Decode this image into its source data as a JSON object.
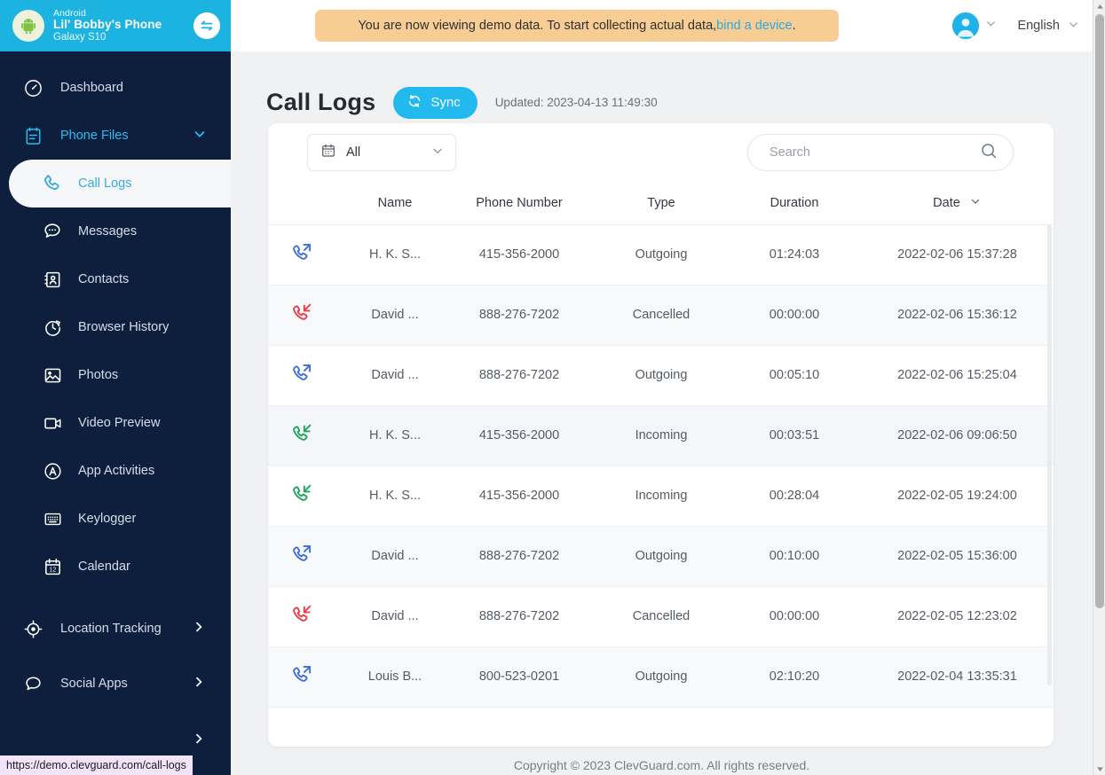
{
  "device": {
    "os": "Android",
    "name": "Lil' Bobby's Phone",
    "model": "Galaxy S10",
    "avatar_icon": "android-robot-icon",
    "switch_icon": "switch-device-icon"
  },
  "header": {
    "banner_text_before": "You are now viewing demo data. To start collecting actual data, ",
    "banner_link": "bind a device",
    "banner_text_after": ".",
    "banner_color": "#f8cd94",
    "user_icon": "user-avatar-icon",
    "user_chevron_icon": "chevron-down-icon",
    "language": "English",
    "language_chevron_icon": "chevron-down-icon"
  },
  "sidebar": {
    "accent_color": "#27bdf0",
    "background_color": "#0d1f3c",
    "items": [
      {
        "label": "Dashboard",
        "icon": "dashboard-gauge-icon",
        "level": "top",
        "active": false,
        "chevron": ""
      },
      {
        "label": "Phone Files",
        "icon": "clipboard-icon",
        "level": "group",
        "active": false,
        "chevron": "down"
      },
      {
        "label": "Call Logs",
        "icon": "phone-handset-icon",
        "level": "sub",
        "active": true,
        "chevron": ""
      },
      {
        "label": "Messages",
        "icon": "chat-bubble-dots-icon",
        "level": "sub",
        "active": false,
        "chevron": ""
      },
      {
        "label": "Contacts",
        "icon": "contact-card-icon",
        "level": "sub",
        "active": false,
        "chevron": ""
      },
      {
        "label": "Browser History",
        "icon": "clock-history-icon",
        "level": "sub",
        "active": false,
        "chevron": ""
      },
      {
        "label": "Photos",
        "icon": "image-photo-icon",
        "level": "sub",
        "active": false,
        "chevron": ""
      },
      {
        "label": "Video Preview",
        "icon": "video-camera-icon",
        "level": "sub",
        "active": false,
        "chevron": ""
      },
      {
        "label": "App Activities",
        "icon": "app-circle-a-icon",
        "level": "sub",
        "active": false,
        "chevron": ""
      },
      {
        "label": "Keylogger",
        "icon": "keyboard-icon",
        "level": "sub",
        "active": false,
        "chevron": ""
      },
      {
        "label": "Calendar",
        "icon": "calendar-icon",
        "level": "sub",
        "active": false,
        "chevron": ""
      },
      {
        "label": "Location Tracking",
        "icon": "location-target-icon",
        "level": "top",
        "active": false,
        "chevron": "right"
      },
      {
        "label": "Social Apps",
        "icon": "chat-bubble-icon",
        "level": "top",
        "active": false,
        "chevron": "right"
      }
    ]
  },
  "page": {
    "title": "Call Logs",
    "sync_label": "Sync",
    "sync_icon": "refresh-sync-icon",
    "sync_color": "#22b9ef",
    "updated_text": "Updated: 2023-04-13 11:49:30"
  },
  "filter": {
    "icon": "calendar-icon",
    "selected": "All",
    "chevron_icon": "chevron-down-icon",
    "options": [
      "All"
    ]
  },
  "search": {
    "placeholder": "Search",
    "value": "",
    "icon": "search-icon"
  },
  "table": {
    "columns": [
      {
        "key": "icon",
        "label": ""
      },
      {
        "key": "name",
        "label": "Name"
      },
      {
        "key": "phone",
        "label": "Phone Number"
      },
      {
        "key": "type",
        "label": "Type"
      },
      {
        "key": "dur",
        "label": "Duration"
      },
      {
        "key": "date",
        "label": "Date"
      }
    ],
    "sorted_column": "Date",
    "sort_icon": "chevron-down-icon",
    "type_colors": {
      "Outgoing": "#3f6fd8",
      "Incoming": "#20a35a",
      "Cancelled": "#e8404a"
    },
    "rows": [
      {
        "icon": "call-outgoing-icon",
        "name": "H. K. S...",
        "phone": "415-356-2000",
        "type": "Outgoing",
        "dur": "01:24:03",
        "date": "2022-02-06 15:37:28"
      },
      {
        "icon": "call-cancelled-icon",
        "name": "David ...",
        "phone": "888-276-7202",
        "type": "Cancelled",
        "dur": "00:00:00",
        "date": "2022-02-06 15:36:12"
      },
      {
        "icon": "call-outgoing-icon",
        "name": "David ...",
        "phone": "888-276-7202",
        "type": "Outgoing",
        "dur": "00:05:10",
        "date": "2022-02-06 15:25:04"
      },
      {
        "icon": "call-incoming-icon",
        "name": "H. K. S...",
        "phone": "415-356-2000",
        "type": "Incoming",
        "dur": "00:03:51",
        "date": "2022-02-06 09:06:50"
      },
      {
        "icon": "call-incoming-icon",
        "name": "H. K. S...",
        "phone": "415-356-2000",
        "type": "Incoming",
        "dur": "00:28:04",
        "date": "2022-02-05 19:24:00"
      },
      {
        "icon": "call-outgoing-icon",
        "name": "David ...",
        "phone": "888-276-7202",
        "type": "Outgoing",
        "dur": "00:10:00",
        "date": "2022-02-05 15:36:00"
      },
      {
        "icon": "call-cancelled-icon",
        "name": "David ...",
        "phone": "888-276-7202",
        "type": "Cancelled",
        "dur": "00:00:00",
        "date": "2022-02-05 12:23:02"
      },
      {
        "icon": "call-outgoing-icon",
        "name": "Louis B...",
        "phone": "800-523-0201",
        "type": "Outgoing",
        "dur": "02:10:20",
        "date": "2022-02-04 13:35:31"
      }
    ]
  },
  "footer": {
    "copyright": "Copyright © 2023 ClevGuard.com. All rights reserved."
  },
  "status_bar": {
    "url": "https://demo.clevguard.com/call-logs"
  }
}
